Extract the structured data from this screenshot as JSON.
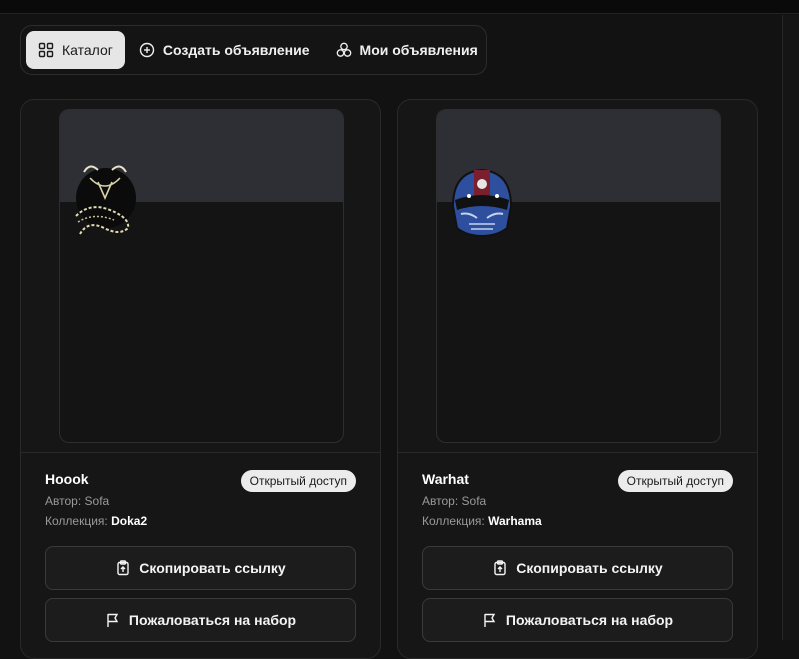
{
  "tabs": [
    {
      "label": "Каталог",
      "icon": "grid-icon",
      "active": true
    },
    {
      "label": "Создать объявление",
      "icon": "plus-circle-icon",
      "active": false
    },
    {
      "label": "Мои объявления",
      "icon": "circles-icon",
      "active": false
    }
  ],
  "cards": [
    {
      "title": "Hoook",
      "badge": "Открытый доступ",
      "author_label": "Автор:",
      "author": "Sofa",
      "collection_label": "Коллекция:",
      "collection": "Doka2",
      "copy_label": "Скопировать ссылку",
      "report_label": "Пожаловаться на набор",
      "image_icon": "hook-item-image"
    },
    {
      "title": "Warhat",
      "badge": "Открытый доступ",
      "author_label": "Автор:",
      "author": "Sofa",
      "collection_label": "Коллекция:",
      "collection": "Warhama",
      "copy_label": "Скопировать ссылку",
      "report_label": "Пожаловаться на набор",
      "image_icon": "helmet-item-image"
    }
  ],
  "colors": {
    "background": "#121212",
    "card": "#161616",
    "band": "#2e2f34",
    "badge": "#ececec",
    "active_tab": "#e6e6e6"
  }
}
